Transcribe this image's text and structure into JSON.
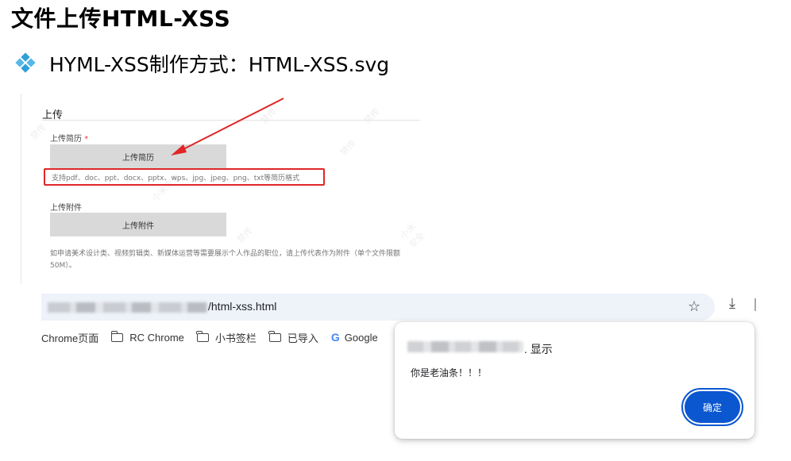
{
  "slide": {
    "title": "文件上传HTML-XSS",
    "bullet_text": "HYML-XSS制作方式：HTML-XSS.svg",
    "bullet_icon": "diamond-cluster-icon",
    "bullet_color": "#2f9fd8"
  },
  "upload_page": {
    "section_title": "上传",
    "resume_label": "上传简历",
    "required_mark": "*",
    "resume_button": "上传简历",
    "format_hint": "支持pdf、doc、ppt、docx、pptx、wps、jpg、jpeg、png、txt等简历格式",
    "attachment_label": "上传附件",
    "attachment_button": "上传附件",
    "note": "如申请美术设计类、视频剪辑类、新媒体运营等需要展示个人作品的职位，请上传代表作为附件（单个文件限额50M）。",
    "highlight_color": "#e02626"
  },
  "browser": {
    "url_suffix": "/html-xss.html",
    "bookmarks": [
      {
        "label": "Chrome页面",
        "icon": "partial-icon"
      },
      {
        "label": "RC Chrome",
        "icon": "folder-icon"
      },
      {
        "label": "小书签栏",
        "icon": "folder-icon"
      },
      {
        "label": "已导入",
        "icon": "folder-icon"
      },
      {
        "label": "Google",
        "icon": "google-icon"
      }
    ]
  },
  "dialog": {
    "title_suffix": ". 显示",
    "message": "你是老油条！！！",
    "ok_label": "确定",
    "accent_color": "#0b57d0"
  }
}
